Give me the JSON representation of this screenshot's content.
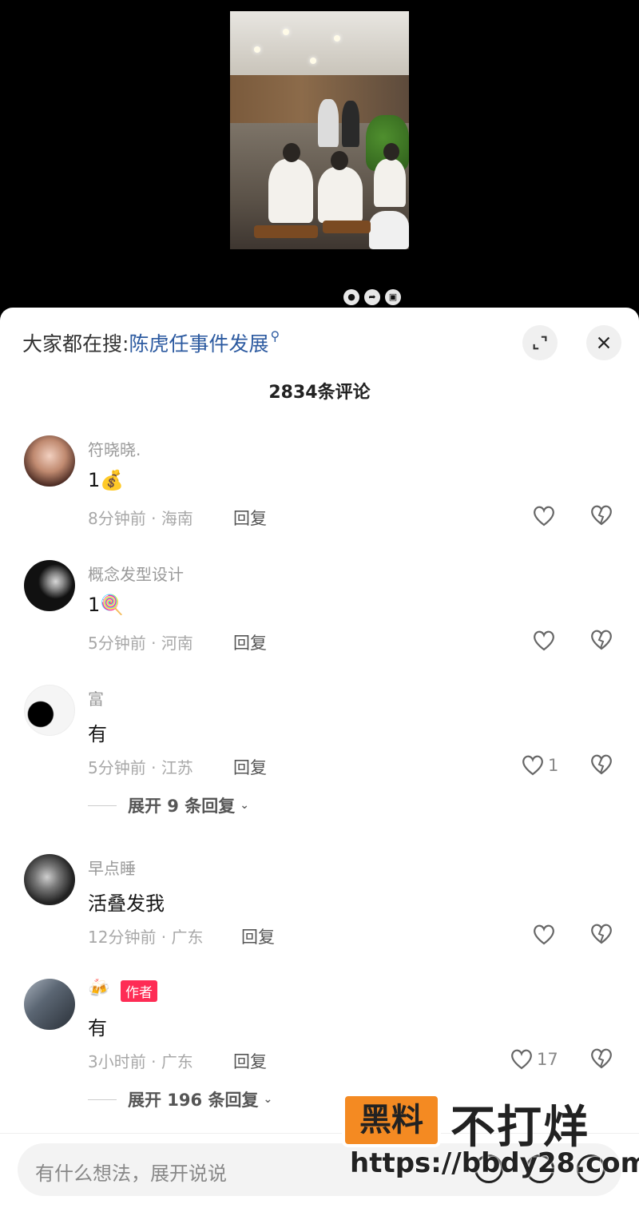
{
  "search": {
    "prefix": "大家都在搜:",
    "query": "陈虎任事件发展",
    "icon": "search-icon"
  },
  "comment_count_label": "2834条评论",
  "comments": [
    {
      "username": "符晓晓.",
      "content": "1💰",
      "time": "8分钟前",
      "location": "海南",
      "reply_label": "回复",
      "likes": "",
      "avatar_color": "#7a4a3a"
    },
    {
      "username": "概念发型设计",
      "content": "1🍭",
      "time": "5分钟前",
      "location": "河南",
      "reply_label": "回复",
      "likes": "",
      "avatar_color": "#111111"
    },
    {
      "username": "富",
      "content": "有",
      "time": "5分钟前",
      "location": "江苏",
      "reply_label": "回复",
      "likes": "1",
      "expand_label": "展开 9 条回复",
      "avatar_color": "#f4f4f4"
    },
    {
      "username": "早点睡",
      "content": "活叠发我",
      "time": "12分钟前",
      "location": "广东",
      "reply_label": "回复",
      "likes": "",
      "avatar_color": "#333333"
    },
    {
      "username": "🍻",
      "badge": "作者",
      "content": "有",
      "time": "3小时前",
      "location": "广东",
      "reply_label": "回复",
      "likes": "17",
      "expand_label": "展开 196 条回复",
      "avatar_color": "#556070"
    }
  ],
  "input": {
    "placeholder": "有什么想法，展开说说"
  },
  "watermark": {
    "box_text": "黑料",
    "main_text": "不打烊",
    "url": "https://bbdy28.com"
  },
  "colors": {
    "accent_link": "#2c5aa0",
    "author_badge": "#fe2c55",
    "watermark_orange": "#f48a22"
  }
}
